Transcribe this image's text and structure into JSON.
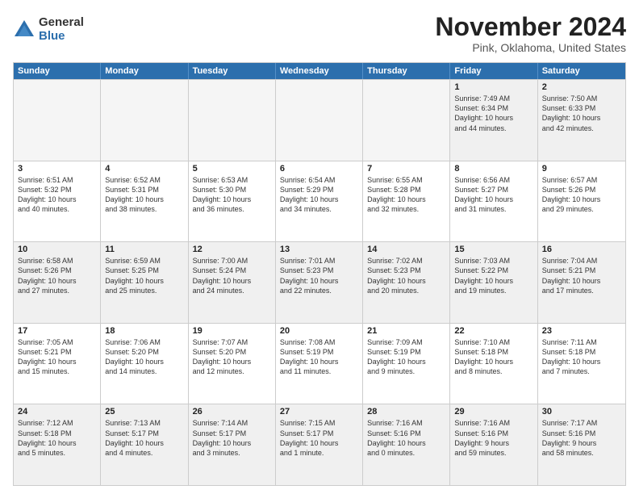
{
  "logo": {
    "general": "General",
    "blue": "Blue"
  },
  "title": {
    "month": "November 2024",
    "location": "Pink, Oklahoma, United States"
  },
  "calendar": {
    "headers": [
      "Sunday",
      "Monday",
      "Tuesday",
      "Wednesday",
      "Thursday",
      "Friday",
      "Saturday"
    ],
    "weeks": [
      [
        {
          "day": "",
          "content": ""
        },
        {
          "day": "",
          "content": ""
        },
        {
          "day": "",
          "content": ""
        },
        {
          "day": "",
          "content": ""
        },
        {
          "day": "",
          "content": ""
        },
        {
          "day": "1",
          "content": "Sunrise: 7:49 AM\nSunset: 6:34 PM\nDaylight: 10 hours\nand 44 minutes."
        },
        {
          "day": "2",
          "content": "Sunrise: 7:50 AM\nSunset: 6:33 PM\nDaylight: 10 hours\nand 42 minutes."
        }
      ],
      [
        {
          "day": "3",
          "content": "Sunrise: 6:51 AM\nSunset: 5:32 PM\nDaylight: 10 hours\nand 40 minutes."
        },
        {
          "day": "4",
          "content": "Sunrise: 6:52 AM\nSunset: 5:31 PM\nDaylight: 10 hours\nand 38 minutes."
        },
        {
          "day": "5",
          "content": "Sunrise: 6:53 AM\nSunset: 5:30 PM\nDaylight: 10 hours\nand 36 minutes."
        },
        {
          "day": "6",
          "content": "Sunrise: 6:54 AM\nSunset: 5:29 PM\nDaylight: 10 hours\nand 34 minutes."
        },
        {
          "day": "7",
          "content": "Sunrise: 6:55 AM\nSunset: 5:28 PM\nDaylight: 10 hours\nand 32 minutes."
        },
        {
          "day": "8",
          "content": "Sunrise: 6:56 AM\nSunset: 5:27 PM\nDaylight: 10 hours\nand 31 minutes."
        },
        {
          "day": "9",
          "content": "Sunrise: 6:57 AM\nSunset: 5:26 PM\nDaylight: 10 hours\nand 29 minutes."
        }
      ],
      [
        {
          "day": "10",
          "content": "Sunrise: 6:58 AM\nSunset: 5:26 PM\nDaylight: 10 hours\nand 27 minutes."
        },
        {
          "day": "11",
          "content": "Sunrise: 6:59 AM\nSunset: 5:25 PM\nDaylight: 10 hours\nand 25 minutes."
        },
        {
          "day": "12",
          "content": "Sunrise: 7:00 AM\nSunset: 5:24 PM\nDaylight: 10 hours\nand 24 minutes."
        },
        {
          "day": "13",
          "content": "Sunrise: 7:01 AM\nSunset: 5:23 PM\nDaylight: 10 hours\nand 22 minutes."
        },
        {
          "day": "14",
          "content": "Sunrise: 7:02 AM\nSunset: 5:23 PM\nDaylight: 10 hours\nand 20 minutes."
        },
        {
          "day": "15",
          "content": "Sunrise: 7:03 AM\nSunset: 5:22 PM\nDaylight: 10 hours\nand 19 minutes."
        },
        {
          "day": "16",
          "content": "Sunrise: 7:04 AM\nSunset: 5:21 PM\nDaylight: 10 hours\nand 17 minutes."
        }
      ],
      [
        {
          "day": "17",
          "content": "Sunrise: 7:05 AM\nSunset: 5:21 PM\nDaylight: 10 hours\nand 15 minutes."
        },
        {
          "day": "18",
          "content": "Sunrise: 7:06 AM\nSunset: 5:20 PM\nDaylight: 10 hours\nand 14 minutes."
        },
        {
          "day": "19",
          "content": "Sunrise: 7:07 AM\nSunset: 5:20 PM\nDaylight: 10 hours\nand 12 minutes."
        },
        {
          "day": "20",
          "content": "Sunrise: 7:08 AM\nSunset: 5:19 PM\nDaylight: 10 hours\nand 11 minutes."
        },
        {
          "day": "21",
          "content": "Sunrise: 7:09 AM\nSunset: 5:19 PM\nDaylight: 10 hours\nand 9 minutes."
        },
        {
          "day": "22",
          "content": "Sunrise: 7:10 AM\nSunset: 5:18 PM\nDaylight: 10 hours\nand 8 minutes."
        },
        {
          "day": "23",
          "content": "Sunrise: 7:11 AM\nSunset: 5:18 PM\nDaylight: 10 hours\nand 7 minutes."
        }
      ],
      [
        {
          "day": "24",
          "content": "Sunrise: 7:12 AM\nSunset: 5:18 PM\nDaylight: 10 hours\nand 5 minutes."
        },
        {
          "day": "25",
          "content": "Sunrise: 7:13 AM\nSunset: 5:17 PM\nDaylight: 10 hours\nand 4 minutes."
        },
        {
          "day": "26",
          "content": "Sunrise: 7:14 AM\nSunset: 5:17 PM\nDaylight: 10 hours\nand 3 minutes."
        },
        {
          "day": "27",
          "content": "Sunrise: 7:15 AM\nSunset: 5:17 PM\nDaylight: 10 hours\nand 1 minute."
        },
        {
          "day": "28",
          "content": "Sunrise: 7:16 AM\nSunset: 5:16 PM\nDaylight: 10 hours\nand 0 minutes."
        },
        {
          "day": "29",
          "content": "Sunrise: 7:16 AM\nSunset: 5:16 PM\nDaylight: 9 hours\nand 59 minutes."
        },
        {
          "day": "30",
          "content": "Sunrise: 7:17 AM\nSunset: 5:16 PM\nDaylight: 9 hours\nand 58 minutes."
        }
      ]
    ]
  }
}
